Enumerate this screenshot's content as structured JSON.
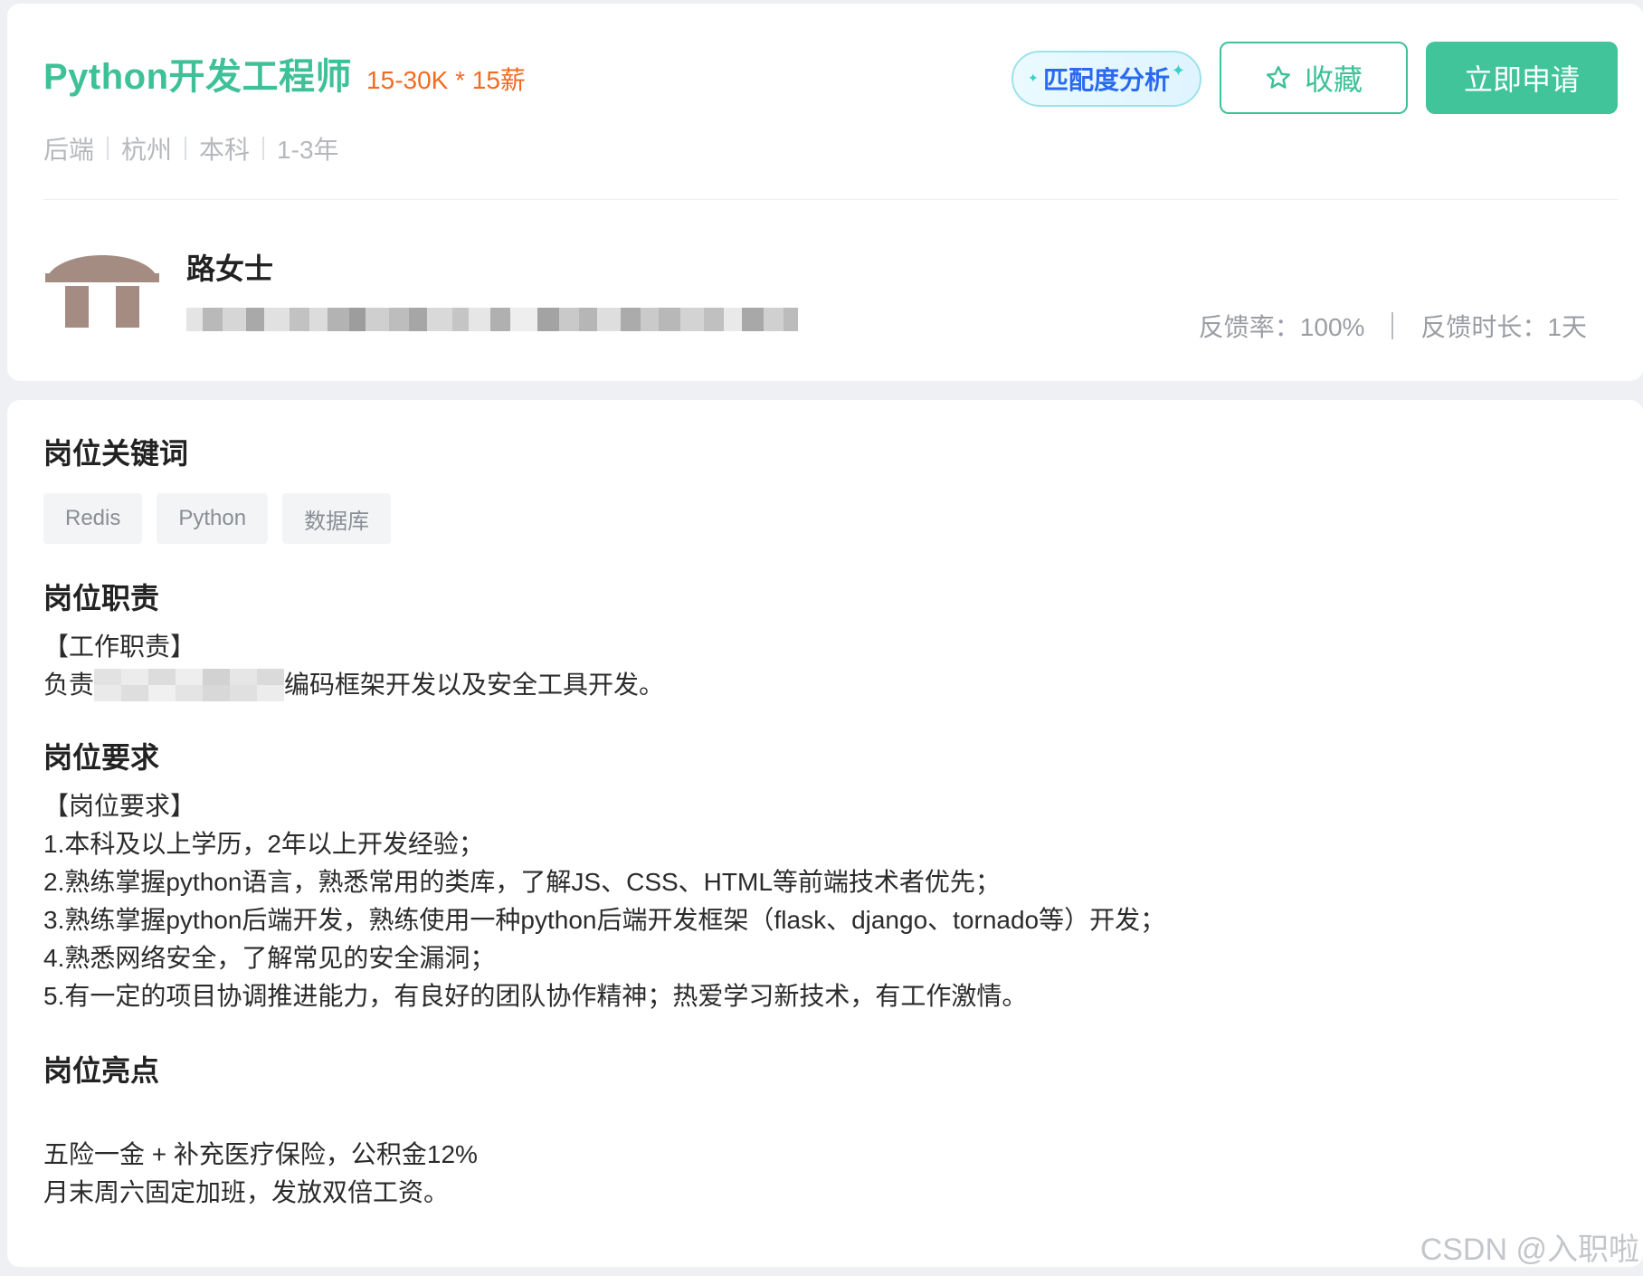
{
  "job": {
    "title": "Python开发工程师",
    "salary": "15-30K * 15薪",
    "meta": [
      "后端",
      "杭州",
      "本科",
      "1-3年"
    ]
  },
  "actions": {
    "match_label": "匹配度分析",
    "favorite_label": "收藏",
    "apply_label": "立即申请"
  },
  "recruiter": {
    "name": "路女士",
    "feedback_rate": "反馈率：100%",
    "feedback_time": "反馈时长：1天"
  },
  "sections": {
    "keywords_title": "岗位关键词",
    "keywords": [
      "Redis",
      "Python",
      "数据库"
    ],
    "duty_title": "岗位职责",
    "duty_heading": "【工作职责】",
    "duty_prefix": "负责",
    "duty_suffix": "编码框架开发以及安全工具开发。",
    "req_title": "岗位要求",
    "req_lines": [
      "【岗位要求】",
      "1.本科及以上学历，2年以上开发经验；",
      "2.熟练掌握python语言，熟悉常用的类库，了解JS、CSS、HTML等前端技术者优先；",
      "3.熟练掌握python后端开发，熟练使用一种python后端开发框架（flask、django、tornado等）开发；",
      "4.熟悉网络安全，了解常见的安全漏洞；",
      "5.有一定的项目协调推进能力，有良好的团队协作精神；热爱学习新技术，有工作激情。"
    ],
    "highlight_title": "岗位亮点",
    "highlight_lines": [
      "五险一金 + 补充医疗保险，公积金12%",
      "月末周六固定加班，发放双倍工资。"
    ]
  },
  "watermark": "CSDN @入职啦",
  "colors": {
    "brand_green": "#3ec198",
    "salary_orange": "#f26b21",
    "match_blue": "#2a6af0"
  }
}
